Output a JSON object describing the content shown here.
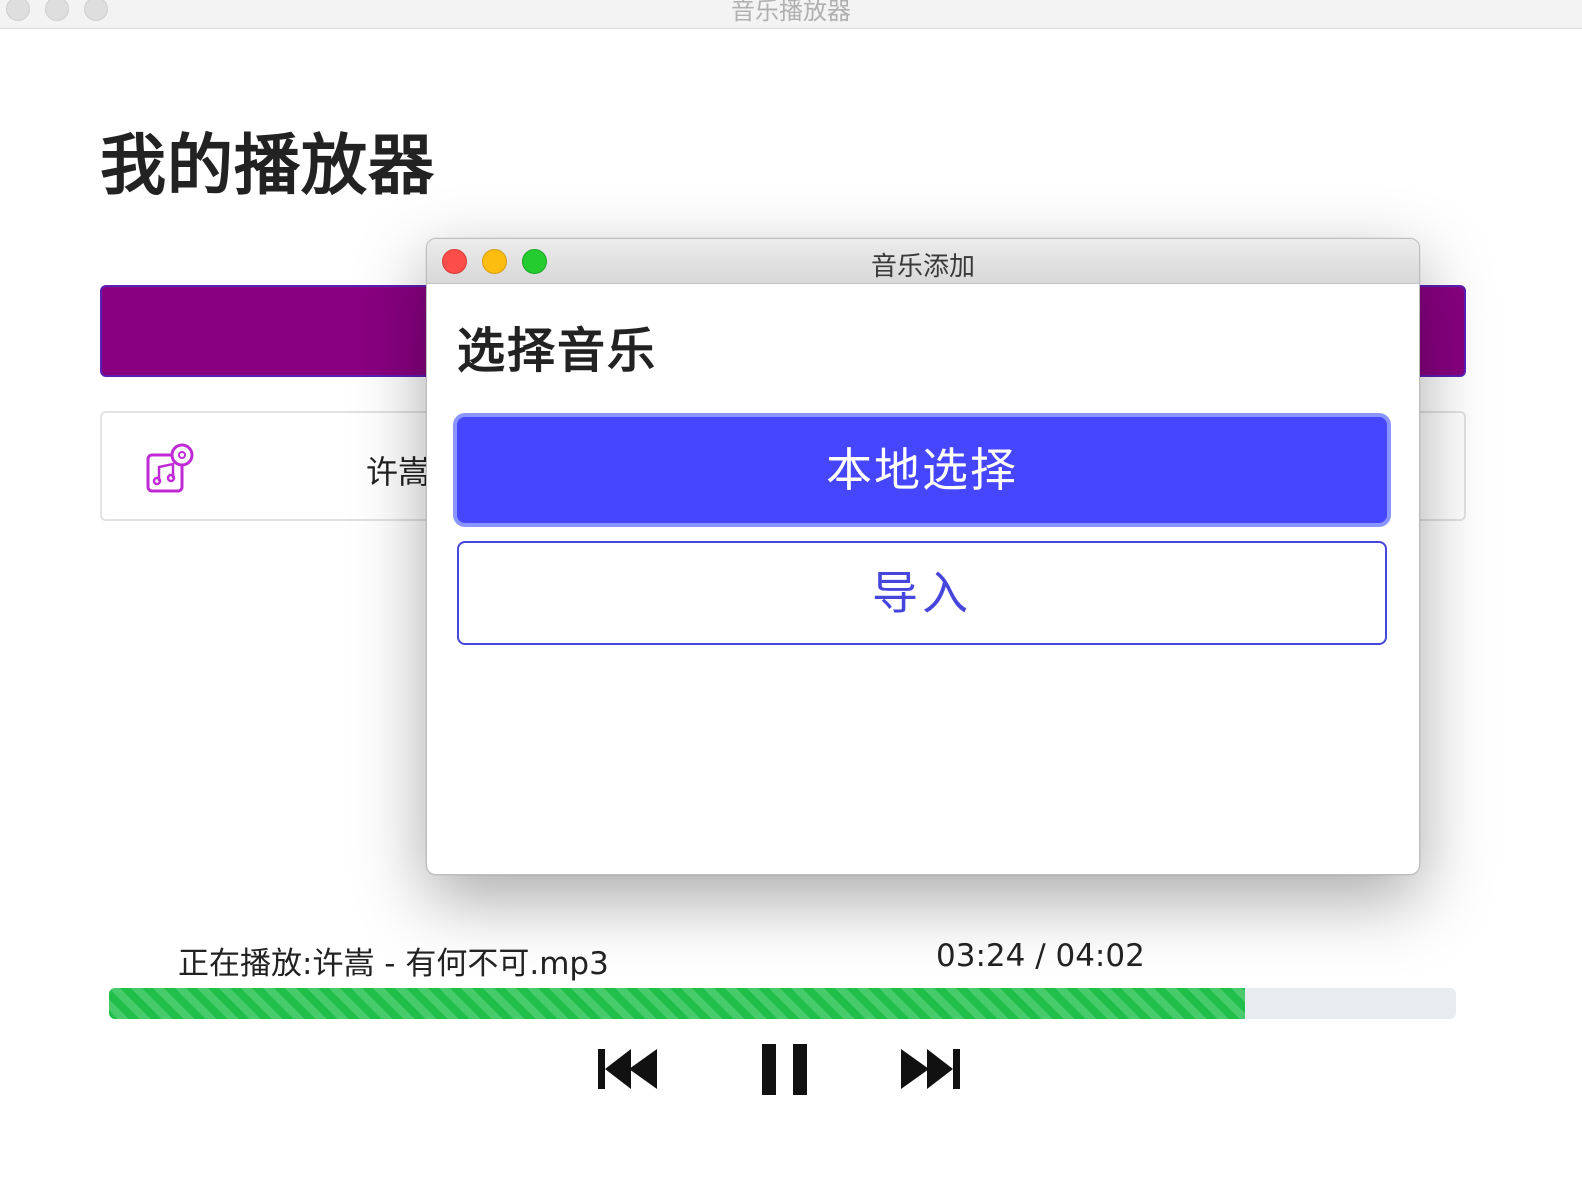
{
  "main_window": {
    "title": "音乐播放器"
  },
  "page": {
    "title": "我的播放器"
  },
  "song_list": {
    "items": [
      {
        "artist_visible": "许嵩",
        "icon": "music-album-icon"
      }
    ]
  },
  "dialog": {
    "title": "音乐添加",
    "heading": "选择音乐",
    "local_button": "本地选择",
    "import_button": "导入"
  },
  "player": {
    "now_playing": "正在播放:许嵩 - 有何不可.mp3",
    "time": "03:24 / 04:02",
    "progress_fraction": 0.843,
    "controls": [
      "previous-icon",
      "pause-icon",
      "next-icon"
    ]
  },
  "colors": {
    "banner": "#880080",
    "primary_button": "#4646ff",
    "outline_button": "#4646dc",
    "progress": "#1fbf4a"
  }
}
